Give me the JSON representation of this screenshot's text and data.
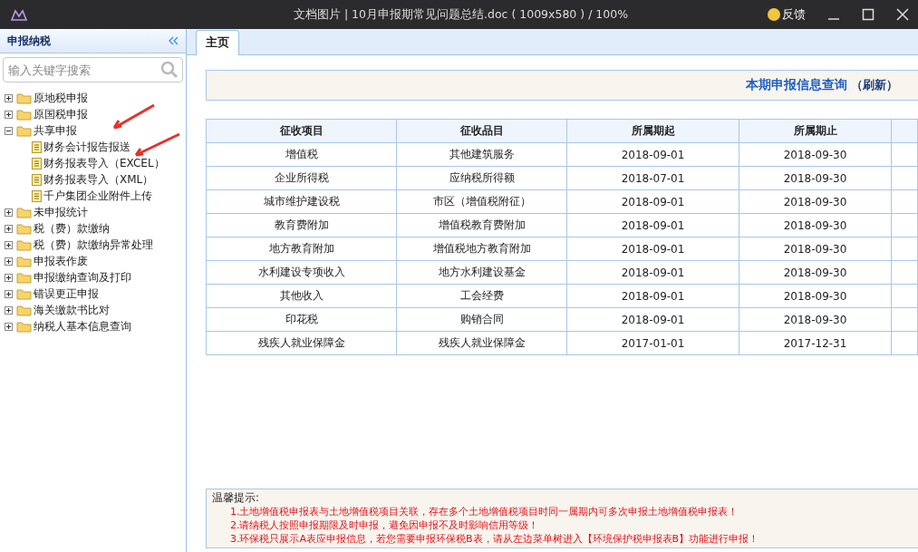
{
  "window": {
    "title": "文档图片 | 10月申报期常见问题总结.doc ( 1009x580 ) / 100%",
    "feedback": "反馈"
  },
  "sidebar": {
    "title": "申报纳税",
    "search": {
      "placeholder": "输入关键字搜索"
    },
    "tree": [
      {
        "label": "原地税申报",
        "expanded": false
      },
      {
        "label": "原国税申报",
        "expanded": false
      },
      {
        "label": "共享申报",
        "expanded": true,
        "children": [
          {
            "label": "财务会计报告报送"
          },
          {
            "label": "财务报表导入（EXCEL）"
          },
          {
            "label": "财务报表导入（XML）"
          },
          {
            "label": "千户集团企业附件上传"
          }
        ]
      },
      {
        "label": "未申报统计",
        "expanded": false
      },
      {
        "label": "税（费）款缴纳",
        "expanded": false
      },
      {
        "label": "税（费）款缴纳异常处理",
        "expanded": false
      },
      {
        "label": "申报表作废",
        "expanded": false
      },
      {
        "label": "申报缴纳查询及打印",
        "expanded": false
      },
      {
        "label": "错误更正申报",
        "expanded": false
      },
      {
        "label": "海关缴款书比对",
        "expanded": false
      },
      {
        "label": "纳税人基本信息查询",
        "expanded": false
      }
    ]
  },
  "tabs": [
    {
      "label": "主页",
      "selected": true
    }
  ],
  "query_header": {
    "title": "本期申报信息查询",
    "refresh": "（刷新）"
  },
  "table": {
    "columns": [
      "征收项目",
      "征收品目",
      "所属期起",
      "所属期止"
    ],
    "rows": [
      [
        "增值税",
        "其他建筑服务",
        "2018-09-01",
        "2018-09-30"
      ],
      [
        "企业所得税",
        "应纳税所得额",
        "2018-07-01",
        "2018-09-30"
      ],
      [
        "城市维护建设税",
        "市区（增值税附征）",
        "2018-09-01",
        "2018-09-30"
      ],
      [
        "教育费附加",
        "增值税教育费附加",
        "2018-09-01",
        "2018-09-30"
      ],
      [
        "地方教育附加",
        "增值税地方教育附加",
        "2018-09-01",
        "2018-09-30"
      ],
      [
        "水利建设专项收入",
        "地方水利建设基金",
        "2018-09-01",
        "2018-09-30"
      ],
      [
        "其他收入",
        "工会经费",
        "2018-09-01",
        "2018-09-30"
      ],
      [
        "印花税",
        "购销合同",
        "2018-09-01",
        "2018-09-30"
      ],
      [
        "残疾人就业保障金",
        "残疾人就业保障金",
        "2017-01-01",
        "2017-12-31"
      ]
    ]
  },
  "notice": {
    "title": "温馨提示:",
    "lines": [
      "1.土地增值税申报表与土地增值税项目关联，存在多个土地增值税项目时同一属期内可多次申报土地增值税申报表！",
      "2.请纳税人按照申报期限及时申报，避免因申报不及时影响信用等级！",
      "3.环保税只展示A表应申报信息，若您需要申报环保税B表，请从左边菜单树进入【环境保护税申报表B】功能进行申报！"
    ]
  }
}
